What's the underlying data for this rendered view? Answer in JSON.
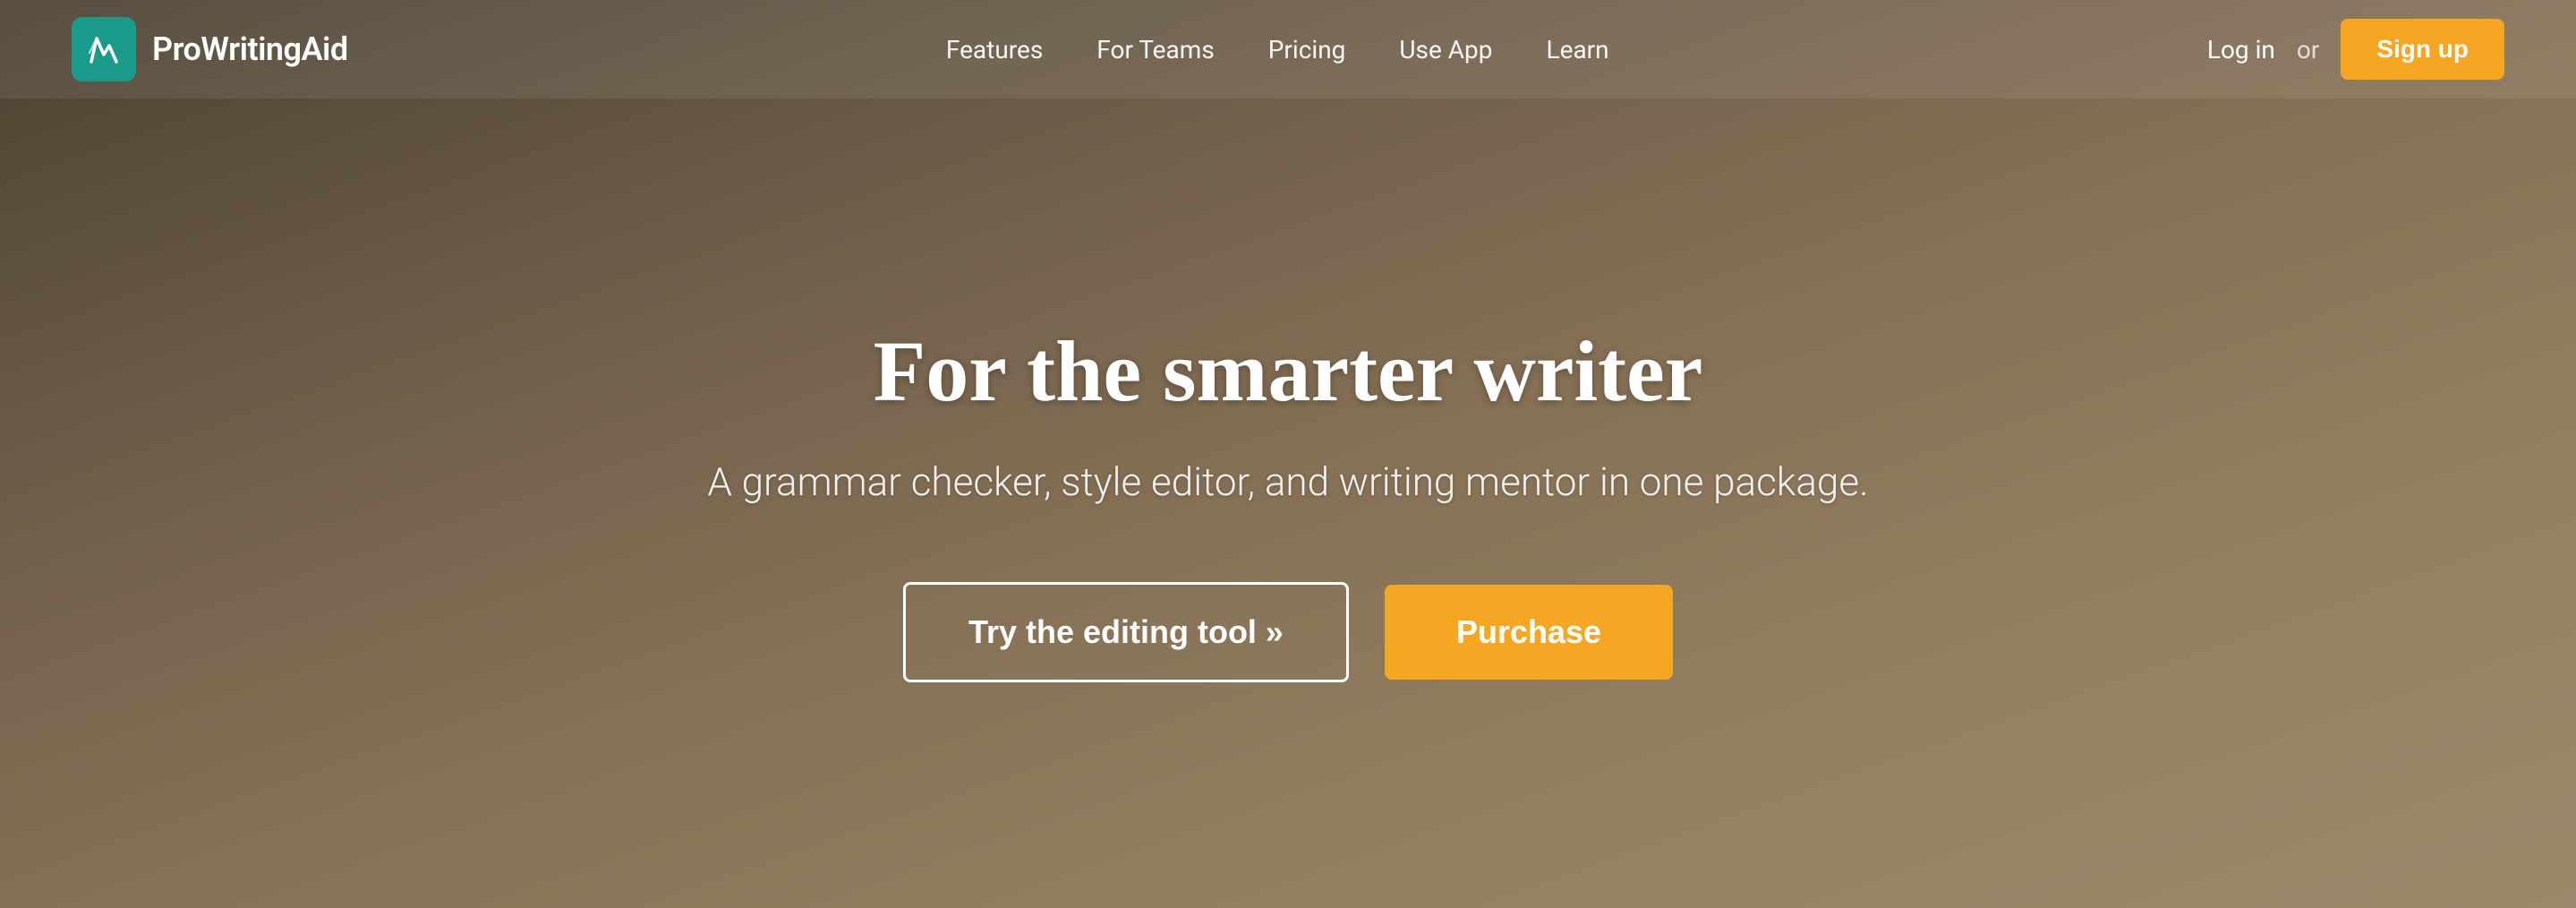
{
  "brand": {
    "name": "ProWritingAid",
    "logo_alt": "ProWritingAid logo"
  },
  "navbar": {
    "links": [
      {
        "label": "Features",
        "id": "features"
      },
      {
        "label": "For Teams",
        "id": "for-teams"
      },
      {
        "label": "Pricing",
        "id": "pricing"
      },
      {
        "label": "Use App",
        "id": "use-app"
      },
      {
        "label": "Learn",
        "id": "learn"
      }
    ],
    "login_label": "Log in",
    "or_label": "or",
    "signup_label": "Sign up"
  },
  "hero": {
    "title": "For the smarter writer",
    "subtitle": "A grammar checker, style editor, and writing mentor in one package.",
    "try_button": "Try the editing tool »",
    "purchase_button": "Purchase"
  },
  "colors": {
    "brand_teal": "#1a9a8a",
    "accent_orange": "#f5a623",
    "text_white": "#ffffff"
  }
}
